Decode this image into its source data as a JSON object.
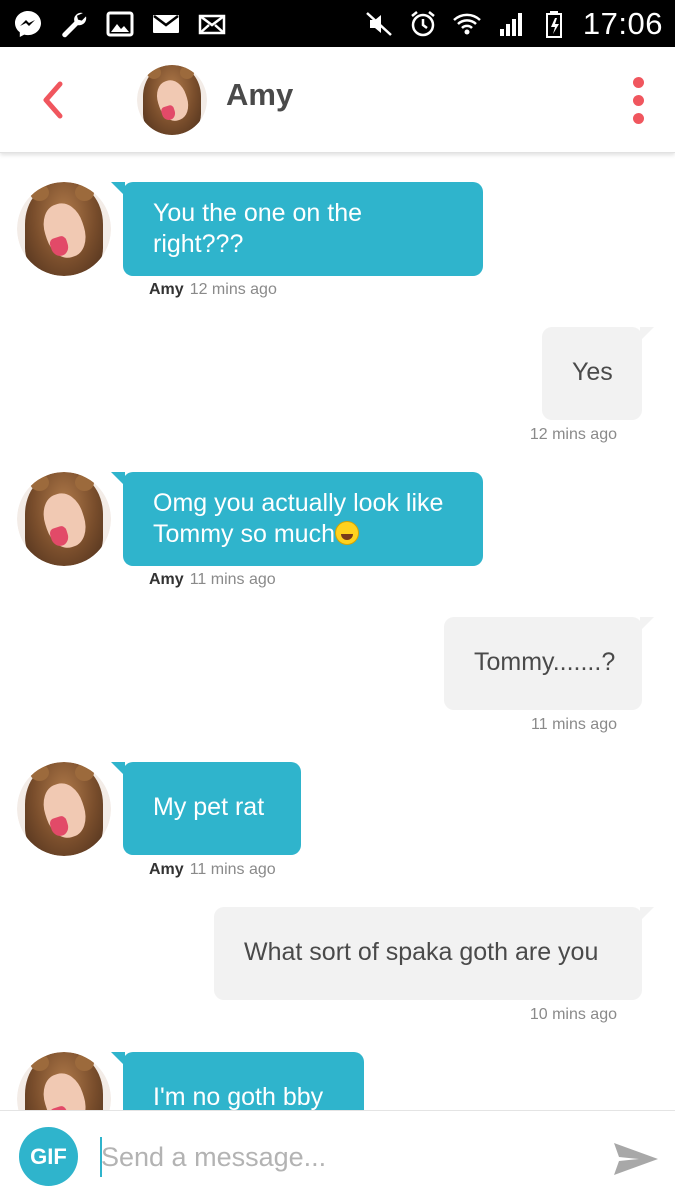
{
  "status_bar": {
    "time": "17:06",
    "left_icons": [
      "messenger-icon",
      "wrench-icon",
      "gallery-icon",
      "gmail-icon",
      "mail-icon"
    ],
    "right_icons": [
      "mute-icon",
      "alarm-icon",
      "wifi-icon",
      "signal-icon",
      "battery-icon"
    ]
  },
  "header": {
    "contact_name": "Amy",
    "accent_color": "#f0565e"
  },
  "messages": [
    {
      "direction": "incoming",
      "text": "You the one on the right???",
      "sender": "Amy",
      "time": "12 mins ago"
    },
    {
      "direction": "outgoing",
      "text": "Yes",
      "time": "12 mins ago"
    },
    {
      "direction": "incoming",
      "text": "Omg you actually look like Tommy so much",
      "emoji": "laughing-emoji",
      "sender": "Amy",
      "time": "11 mins ago"
    },
    {
      "direction": "outgoing",
      "text": "Tommy.......?",
      "time": "11 mins ago"
    },
    {
      "direction": "incoming",
      "text": "My pet rat",
      "sender": "Amy",
      "time": "11 mins ago"
    },
    {
      "direction": "outgoing",
      "text": "What sort of spaka goth are you",
      "time": "10 mins ago"
    },
    {
      "direction": "incoming",
      "text": "I'm no goth bby"
    }
  ],
  "composer": {
    "gif_label": "GIF",
    "placeholder": "Send a message...",
    "value": ""
  },
  "colors": {
    "incoming_bubble": "#2fb4cc",
    "outgoing_bubble": "#f2f2f2",
    "status_bar": "#000000"
  }
}
